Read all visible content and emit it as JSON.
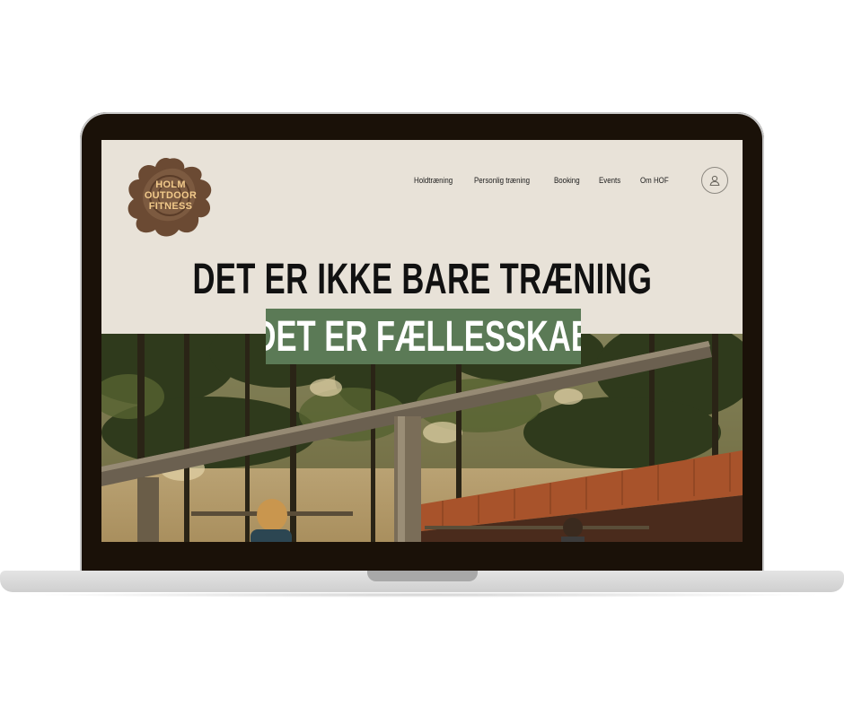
{
  "logo": {
    "line1": "HOLM",
    "line2": "OUTDOOR",
    "line3": "FITNESS"
  },
  "nav": {
    "items": [
      {
        "label": "Holdtræning"
      },
      {
        "label": "Personlig træning"
      },
      {
        "label": "Booking"
      },
      {
        "label": "Events"
      },
      {
        "label": "Om HOF"
      }
    ]
  },
  "user_icon": "user-icon",
  "hero": {
    "headline": "DET ER IKKE BARE TRÆNING",
    "subheadline": "DET ER FÆLLESSKAB"
  },
  "colors": {
    "accent_green": "#5b7a56",
    "page_bg": "#e8e2d8",
    "logo_brown": "#6b4a33",
    "logo_text": "#f1c98a"
  }
}
